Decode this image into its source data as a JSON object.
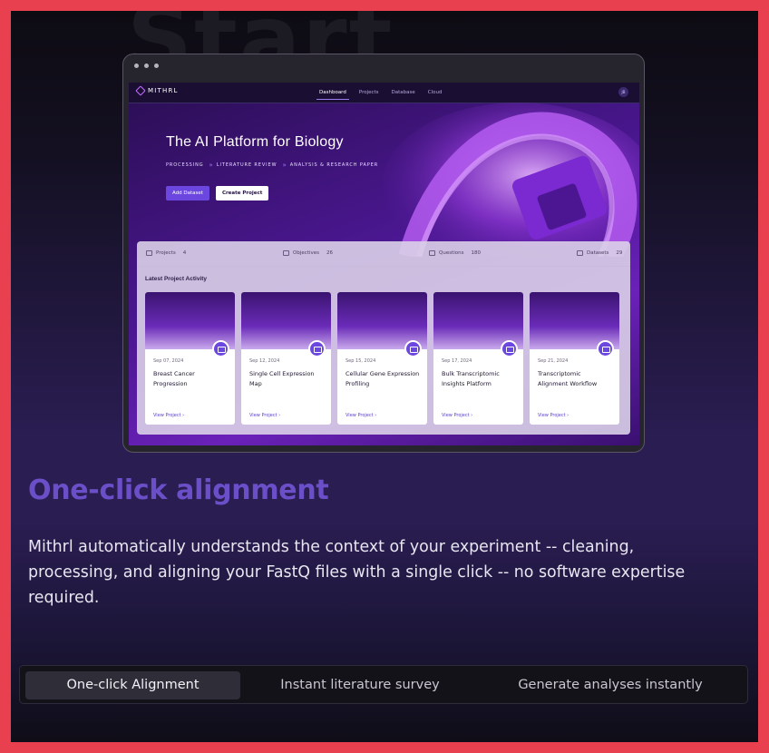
{
  "background_word": "Start",
  "preview": {
    "app_brand": "MITHRL",
    "nav_links": [
      {
        "label": "Dashboard",
        "active": true
      },
      {
        "label": "Projects",
        "active": false
      },
      {
        "label": "Database",
        "active": false
      },
      {
        "label": "Cloud",
        "active": false
      }
    ],
    "avatar_initials": "JB",
    "hero_title": "The AI Platform for Biology",
    "hero_steps": [
      "PROCESSING",
      "LITERATURE REVIEW",
      "ANALYSIS & RESEARCH PAPER"
    ],
    "step_separator": "»",
    "primary_button": "Add Dataset",
    "secondary_button": "Create Project",
    "stats": [
      {
        "label": "Projects",
        "value": "4"
      },
      {
        "label": "Objectives",
        "value": "26"
      },
      {
        "label": "Questions",
        "value": "180"
      },
      {
        "label": "Datasets",
        "value": "29"
      }
    ],
    "activity_title": "Latest Project Activity",
    "cards": [
      {
        "date": "Sep 07, 2024",
        "title": "Breast Cancer Progression",
        "link": "View Project  ›"
      },
      {
        "date": "Sep 12, 2024",
        "title": "Single Cell Expression Map",
        "link": "View Project  ›"
      },
      {
        "date": "Sep 15, 2024",
        "title": "Cellular Gene Expression Profiling",
        "link": "View Project  ›"
      },
      {
        "date": "Sep 17, 2024",
        "title": "Bulk Transcriptomic Insights Platform",
        "link": "View Project  ›"
      },
      {
        "date": "Sep 21, 2024",
        "title": "Transcriptomic Alignment Workflow",
        "link": "View Project  ›"
      }
    ]
  },
  "feature": {
    "heading": "One-click alignment",
    "description": "Mithrl automatically understands the context of your experiment -- cleaning, processing, and aligning your FastQ files with a single click -- no software expertise required."
  },
  "tabs": [
    {
      "label": "One-click Alignment",
      "active": true
    },
    {
      "label": "Instant literature survey",
      "active": false
    },
    {
      "label": "Generate analyses instantly",
      "active": false
    }
  ],
  "colors": {
    "border": "#e8404f",
    "accent": "#6b4fc9",
    "button_primary": "#6b47e0"
  }
}
